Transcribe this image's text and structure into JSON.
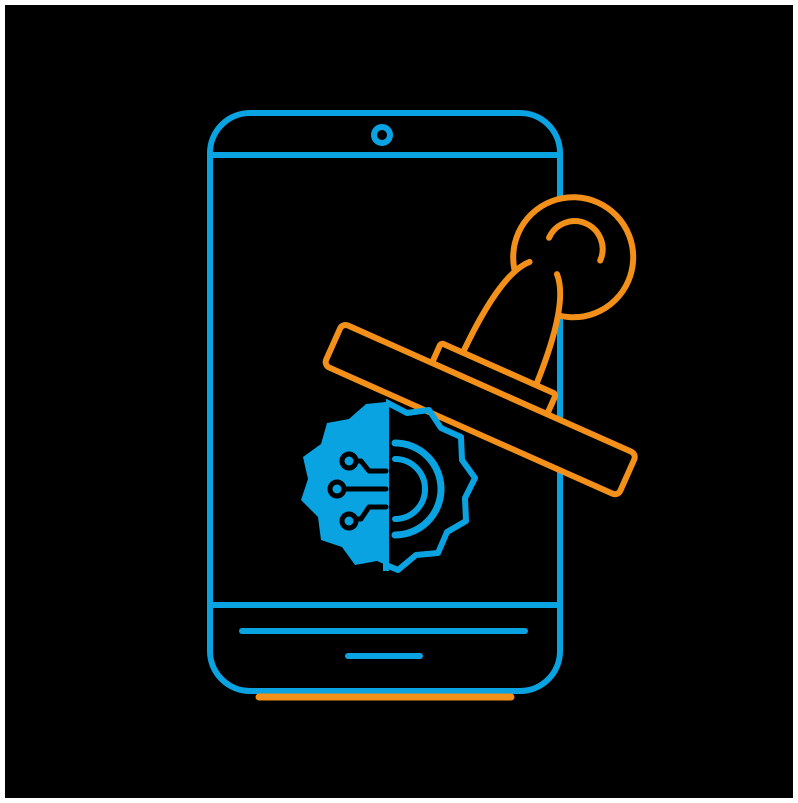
{
  "illustration": {
    "icons": [
      "smartphone-icon",
      "rubber-stamp-icon",
      "digital-gear-icon"
    ],
    "colors": {
      "background": "#000000",
      "primary_blue": "#0aa3e2",
      "accent_orange": "#f39019"
    }
  }
}
